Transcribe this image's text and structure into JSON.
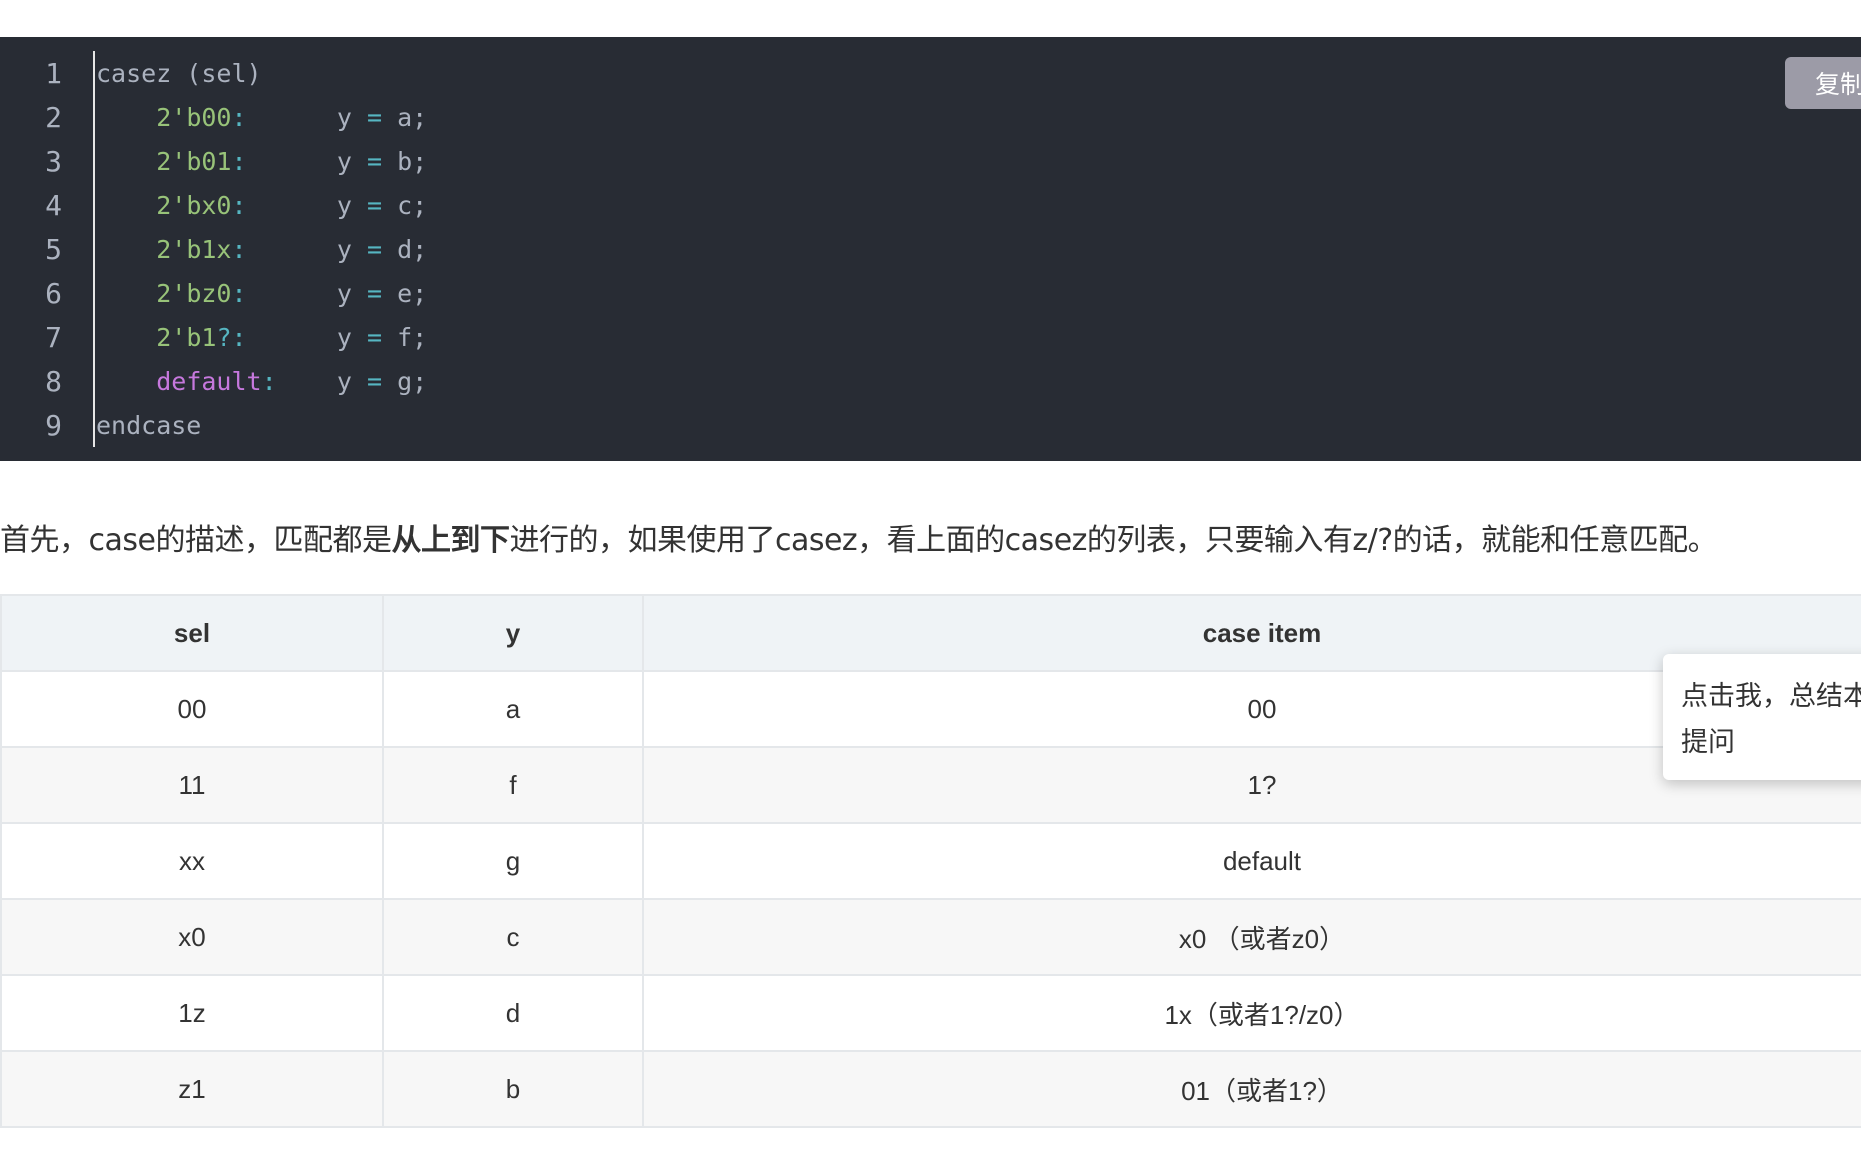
{
  "code": {
    "copy_label": "复制",
    "lines": [
      {
        "no": "1",
        "tokens": [
          {
            "t": "casez (sel)",
            "c": "plain"
          }
        ]
      },
      {
        "no": "2",
        "tokens": [
          {
            "t": "    ",
            "c": "plain"
          },
          {
            "t": "2",
            "c": "num"
          },
          {
            "t": "'b00",
            "c": "str"
          },
          {
            "t": ":",
            "c": "op"
          },
          {
            "t": "      y ",
            "c": "plain"
          },
          {
            "t": "=",
            "c": "op"
          },
          {
            "t": " a;",
            "c": "plain"
          }
        ]
      },
      {
        "no": "3",
        "tokens": [
          {
            "t": "    ",
            "c": "plain"
          },
          {
            "t": "2",
            "c": "num"
          },
          {
            "t": "'b01",
            "c": "str"
          },
          {
            "t": ":",
            "c": "op"
          },
          {
            "t": "      y ",
            "c": "plain"
          },
          {
            "t": "=",
            "c": "op"
          },
          {
            "t": " b;",
            "c": "plain"
          }
        ]
      },
      {
        "no": "4",
        "tokens": [
          {
            "t": "    ",
            "c": "plain"
          },
          {
            "t": "2",
            "c": "num"
          },
          {
            "t": "'bx0",
            "c": "str"
          },
          {
            "t": ":",
            "c": "op"
          },
          {
            "t": "      y ",
            "c": "plain"
          },
          {
            "t": "=",
            "c": "op"
          },
          {
            "t": " c;",
            "c": "plain"
          }
        ]
      },
      {
        "no": "5",
        "tokens": [
          {
            "t": "    ",
            "c": "plain"
          },
          {
            "t": "2",
            "c": "num"
          },
          {
            "t": "'b1x",
            "c": "str"
          },
          {
            "t": ":",
            "c": "op"
          },
          {
            "t": "      y ",
            "c": "plain"
          },
          {
            "t": "=",
            "c": "op"
          },
          {
            "t": " d;",
            "c": "plain"
          }
        ]
      },
      {
        "no": "6",
        "tokens": [
          {
            "t": "    ",
            "c": "plain"
          },
          {
            "t": "2",
            "c": "num"
          },
          {
            "t": "'bz0",
            "c": "str"
          },
          {
            "t": ":",
            "c": "op"
          },
          {
            "t": "      y ",
            "c": "plain"
          },
          {
            "t": "=",
            "c": "op"
          },
          {
            "t": " e;",
            "c": "plain"
          }
        ]
      },
      {
        "no": "7",
        "tokens": [
          {
            "t": "    ",
            "c": "plain"
          },
          {
            "t": "2",
            "c": "num"
          },
          {
            "t": "'b1",
            "c": "str"
          },
          {
            "t": "?:",
            "c": "op"
          },
          {
            "t": "      y ",
            "c": "plain"
          },
          {
            "t": "=",
            "c": "op"
          },
          {
            "t": " f;",
            "c": "plain"
          }
        ]
      },
      {
        "no": "8",
        "tokens": [
          {
            "t": "    ",
            "c": "plain"
          },
          {
            "t": "default",
            "c": "kw"
          },
          {
            "t": ":",
            "c": "op"
          },
          {
            "t": "    y ",
            "c": "plain"
          },
          {
            "t": "=",
            "c": "op"
          },
          {
            "t": " g;",
            "c": "plain"
          }
        ]
      },
      {
        "no": "9",
        "tokens": [
          {
            "t": "endcase",
            "c": "plain"
          }
        ]
      }
    ]
  },
  "paragraph": {
    "before": "首先，case的描述，匹配都是",
    "bold": "从上到下",
    "after": "进行的，如果使用了casez，看上面的casez的列表，只要输入有z/?的话，就能和任意匹配。"
  },
  "table": {
    "headers": [
      "sel",
      "y",
      "case item"
    ],
    "rows": [
      [
        "00",
        "a",
        "00"
      ],
      [
        "11",
        "f",
        "1?"
      ],
      [
        "xx",
        "g",
        "default"
      ],
      [
        "x0",
        "c",
        "x0 （或者z0）"
      ],
      [
        "1z",
        "d",
        "1x（或者1?/z0）"
      ],
      [
        "z1",
        "b",
        "01（或者1?）"
      ]
    ]
  },
  "popup": {
    "line1": "点击我，总结本",
    "line2": "提问"
  },
  "colors": {
    "code_bg": "#282c34",
    "code_text": "#abb2bf",
    "code_green": "#98c379",
    "code_purple": "#c678dd",
    "code_op": "#56b6c2",
    "table_header_bg": "#eff3f6",
    "table_border": "#e4e7ea",
    "copy_button_bg": "#9c9ba7"
  }
}
